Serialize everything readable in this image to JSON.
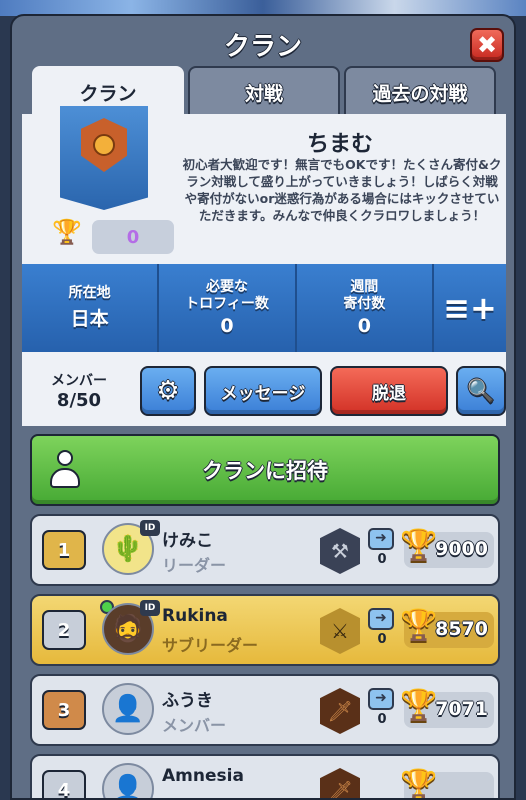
{
  "header": {
    "title": "クラン",
    "close_label": "✖"
  },
  "tabs": [
    {
      "label": "クラン",
      "active": true
    },
    {
      "label": "対戦",
      "active": false
    },
    {
      "label": "過去の対戦",
      "active": false
    }
  ],
  "clan": {
    "name": "ちまむ",
    "description": "初心者大歓迎です！無言でもOKです！たくさん寄付&クラン対戦して盛り上がっていきましょう！しばらく対戦や寄付がないor迷惑行為がある場合にはキックさせていただきます。みんなで仲良くクラロワしましょう！",
    "trophies": "0"
  },
  "stats": [
    {
      "label": "所在地",
      "value": "日本"
    },
    {
      "label": "必要な\nトロフィー数",
      "value": "0"
    },
    {
      "label": "週間\n寄付数",
      "value": "0"
    }
  ],
  "members_bar": {
    "label": "メンバー",
    "count": "8/50",
    "message_label": "メッセージ",
    "leave_label": "脱退"
  },
  "invite_label": "クランに招待",
  "members": [
    {
      "rank": "1",
      "name": "けみこ",
      "role": "リーダー",
      "donations": "0",
      "trophies": "9000"
    },
    {
      "rank": "2",
      "name": "Rukina",
      "role": "サブリーダー",
      "donations": "0",
      "trophies": "8570"
    },
    {
      "rank": "3",
      "name": "ふうき",
      "role": "メンバー",
      "donations": "0",
      "trophies": "7071"
    },
    {
      "rank": "4",
      "name": "Amnesia",
      "role": "",
      "donations": "",
      "trophies": ""
    }
  ],
  "colors": {
    "accent_blue": "#2a6fc4",
    "leave_red": "#d23126",
    "invite_green": "#46a934",
    "highlight_gold": "#e6b93c"
  }
}
